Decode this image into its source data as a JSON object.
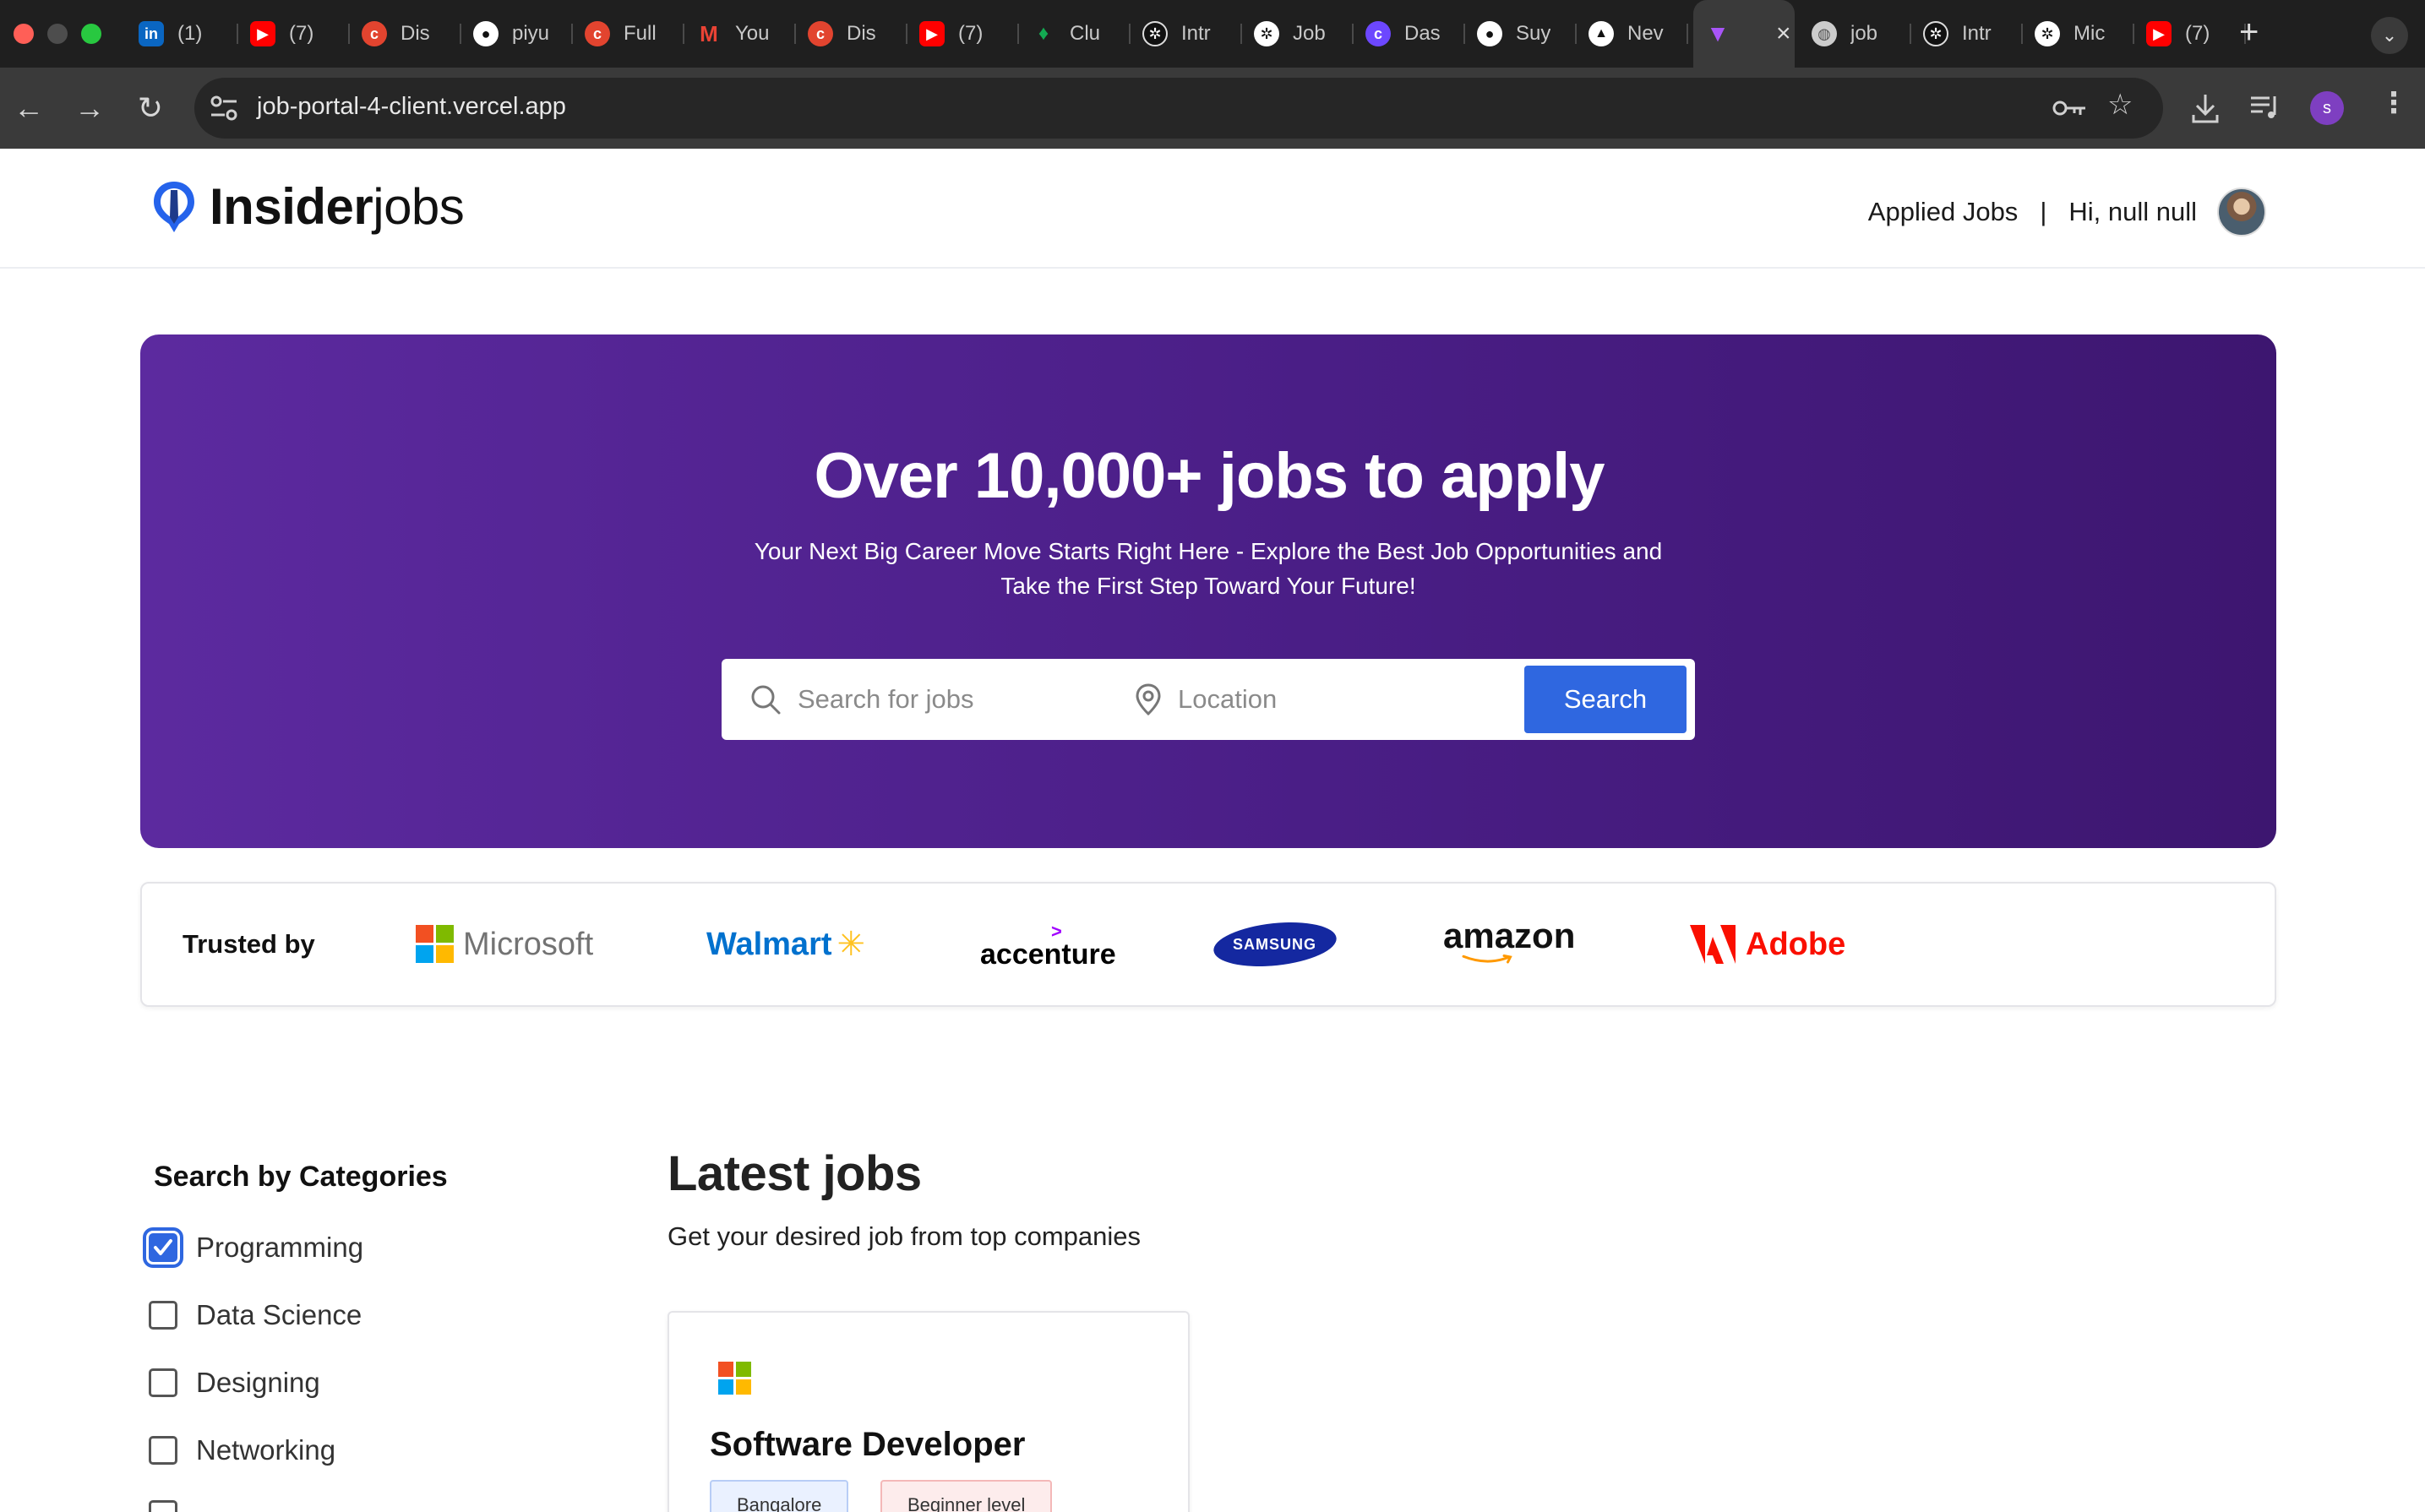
{
  "browser": {
    "tabs": [
      {
        "label": "(1)",
        "icon": "linkedin-icon",
        "color": "#0a66c2"
      },
      {
        "label": "(7)",
        "icon": "youtube-icon",
        "color": "#ff0000"
      },
      {
        "label": "Dis",
        "icon": "chai-icon",
        "color": "#e2442f"
      },
      {
        "label": "piyu",
        "icon": "github-icon",
        "color": "#ffffff"
      },
      {
        "label": "Full",
        "icon": "chai-icon",
        "color": "#e2442f"
      },
      {
        "label": "You",
        "icon": "gmail-icon",
        "color": "#ea4335"
      },
      {
        "label": "Dis",
        "icon": "chai-icon",
        "color": "#e2442f"
      },
      {
        "label": "(7)",
        "icon": "youtube-icon",
        "color": "#ff0000"
      },
      {
        "label": "Clu",
        "icon": "mongodb-icon",
        "color": "#13aa52"
      },
      {
        "label": "Intr",
        "icon": "openai-icon",
        "color": "#ffffff"
      },
      {
        "label": "Job",
        "icon": "openai-icon",
        "color": "#ffffff"
      },
      {
        "label": "Das",
        "icon": "clerk-icon",
        "color": "#6c47ff"
      },
      {
        "label": "Suy",
        "icon": "github-icon",
        "color": "#ffffff"
      },
      {
        "label": "Nev",
        "icon": "vercel-icon",
        "color": "#ffffff"
      },
      {
        "label": "",
        "icon": "vite-icon",
        "color": "#a855f7",
        "active": true
      },
      {
        "label": "job",
        "icon": "globe-icon",
        "color": "#cccccc"
      },
      {
        "label": "Intr",
        "icon": "openai-icon",
        "color": "#ffffff"
      },
      {
        "label": "Mic",
        "icon": "openai-icon",
        "color": "#ffffff"
      },
      {
        "label": "(7)",
        "icon": "youtube-icon",
        "color": "#ff0000"
      }
    ],
    "url": "job-portal-4-client.vercel.app",
    "profile_initial": "s"
  },
  "navbar": {
    "logo_bold": "Insider",
    "logo_light": "jobs",
    "applied_jobs": "Applied Jobs",
    "separator": "|",
    "greeting": "Hi, null null"
  },
  "hero": {
    "title": "Over 10,000+ jobs to apply",
    "subtitle": "Your Next Big Career Move Starts Right Here - Explore the Best Job Opportunities and Take the First Step Toward Your Future!",
    "search_placeholder": "Search for jobs",
    "location_placeholder": "Location",
    "search_button": "Search",
    "accent_color": "#2f67e0"
  },
  "trusted": {
    "label": "Trusted by",
    "brands": {
      "microsoft": "Microsoft",
      "walmart": "Walmart",
      "accenture": "accenture",
      "samsung": "SAMSUNG",
      "amazon": "amazon",
      "adobe": "Adobe"
    }
  },
  "categories": {
    "title": "Search by Categories",
    "items": [
      {
        "label": "Programming",
        "checked": true
      },
      {
        "label": "Data Science",
        "checked": false
      },
      {
        "label": "Designing",
        "checked": false
      },
      {
        "label": "Networking",
        "checked": false
      }
    ]
  },
  "latest": {
    "title": "Latest jobs",
    "subtitle": "Get your desired job from top companies",
    "jobs": [
      {
        "title": "Software Developer",
        "company_logo": "microsoft-logo",
        "location": "Bangalore",
        "level": "Beginner level"
      }
    ]
  }
}
